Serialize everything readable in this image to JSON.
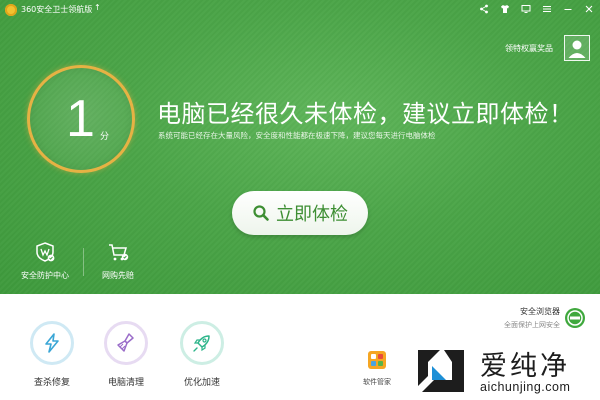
{
  "window": {
    "title": "360安全卫士领航版",
    "icons": [
      "share-icon",
      "shirt-icon",
      "monitor-icon",
      "menu-icon",
      "minimize-icon",
      "close-icon"
    ]
  },
  "user": {
    "claim_link": "领特权赢奖品"
  },
  "score": {
    "value": "1",
    "unit": "分"
  },
  "hero": {
    "headline": "电脑已经很久未体检，建议立即体检！",
    "subline": "系统可能已经存在大量风险，安全度和性能都在极速下降，建议您每天进行电脑体检",
    "check_button": "立即体检",
    "tools": [
      {
        "label": "安全防护中心",
        "icon": "shield-icon"
      },
      {
        "label": "网购先赔",
        "icon": "cart-icon"
      }
    ]
  },
  "bottom": {
    "tools": [
      {
        "label": "查杀修复",
        "icon": "lightning-icon"
      },
      {
        "label": "电脑清理",
        "icon": "brush-icon"
      },
      {
        "label": "优化加速",
        "icon": "rocket-icon"
      }
    ],
    "browser": {
      "title": "安全浏览器",
      "subtitle": "全面保护上网安全"
    },
    "software_manager": "软件管家"
  },
  "watermark": {
    "chinese": "爱纯净",
    "domain": "aichunjing.com"
  },
  "colors": {
    "hero_green": "#4ba548",
    "score_ring": "#e6b244",
    "button_text": "#3d8e33"
  }
}
